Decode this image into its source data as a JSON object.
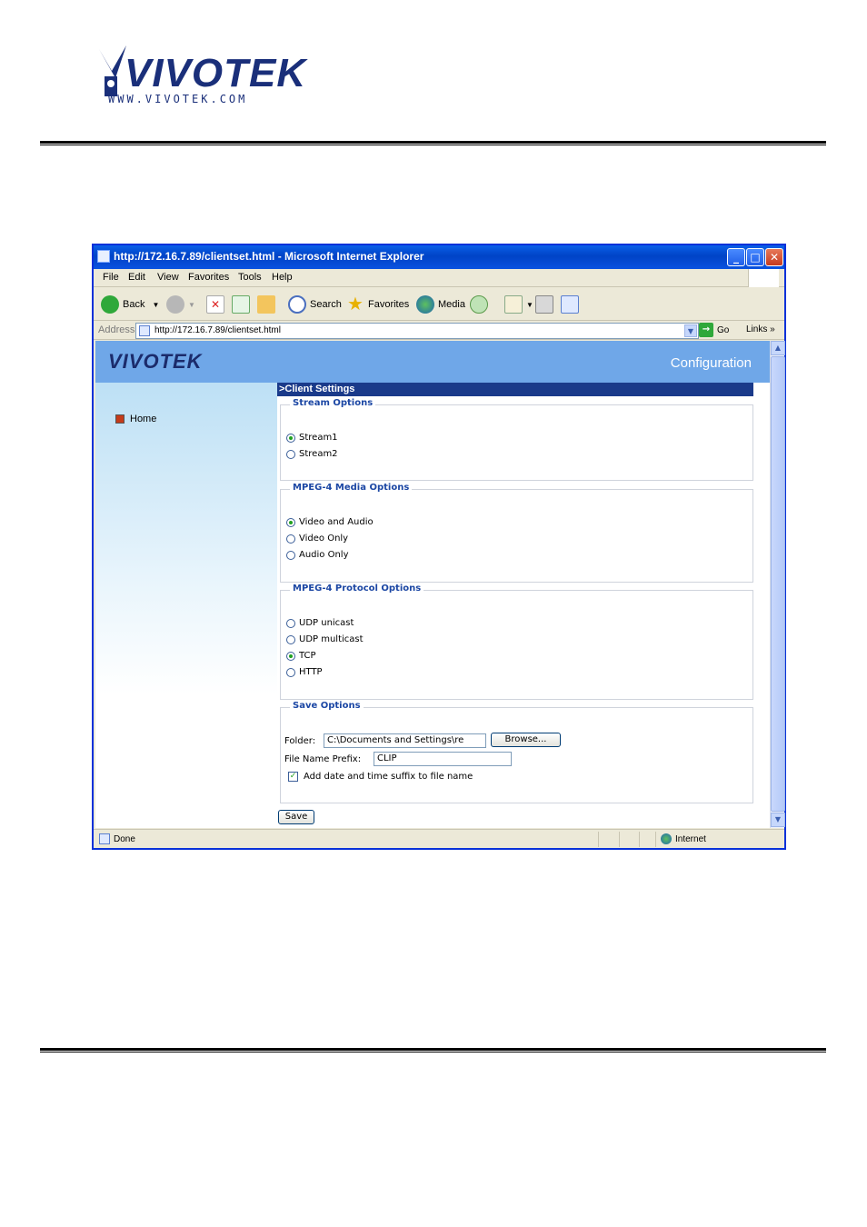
{
  "document": {
    "logo_text": "VIVOTEK",
    "logo_url": "WWW.VIVOTEK.COM"
  },
  "window": {
    "title": "http://172.16.7.89/clientset.html - Microsoft Internet Explorer",
    "menu": [
      "File",
      "Edit",
      "View",
      "Favorites",
      "Tools",
      "Help"
    ],
    "toolbar": {
      "back": "Back",
      "search": "Search",
      "favorites": "Favorites",
      "media": "Media"
    },
    "address": {
      "label": "Address",
      "url": "http://172.16.7.89/clientset.html",
      "go": "Go",
      "links": "Links"
    },
    "status": {
      "text": "Done",
      "zone": "Internet"
    }
  },
  "page": {
    "brand": "VIVOTEK",
    "header_title": "Configuration",
    "nav": {
      "home": "Home"
    },
    "section_title": ">Client Settings",
    "stream_options": {
      "legend": "Stream Options",
      "options": [
        "Stream1",
        "Stream2"
      ],
      "selected": "Stream1"
    },
    "media_options": {
      "legend": "MPEG-4 Media Options",
      "options": [
        "Video and Audio",
        "Video Only",
        "Audio Only"
      ],
      "selected": "Video and Audio"
    },
    "protocol_options": {
      "legend": "MPEG-4 Protocol Options",
      "options": [
        "UDP unicast",
        "UDP multicast",
        "TCP",
        "HTTP"
      ],
      "selected": "TCP"
    },
    "save_options": {
      "legend": "Save Options",
      "folder_label": "Folder:",
      "folder_value": "C:\\Documents and Settings\\re",
      "browse": "Browse...",
      "prefix_label": "File Name Prefix:",
      "prefix_value": "CLIP",
      "suffix_label": "Add date and time suffix to file name",
      "suffix_checked": true
    },
    "save_button": "Save"
  }
}
